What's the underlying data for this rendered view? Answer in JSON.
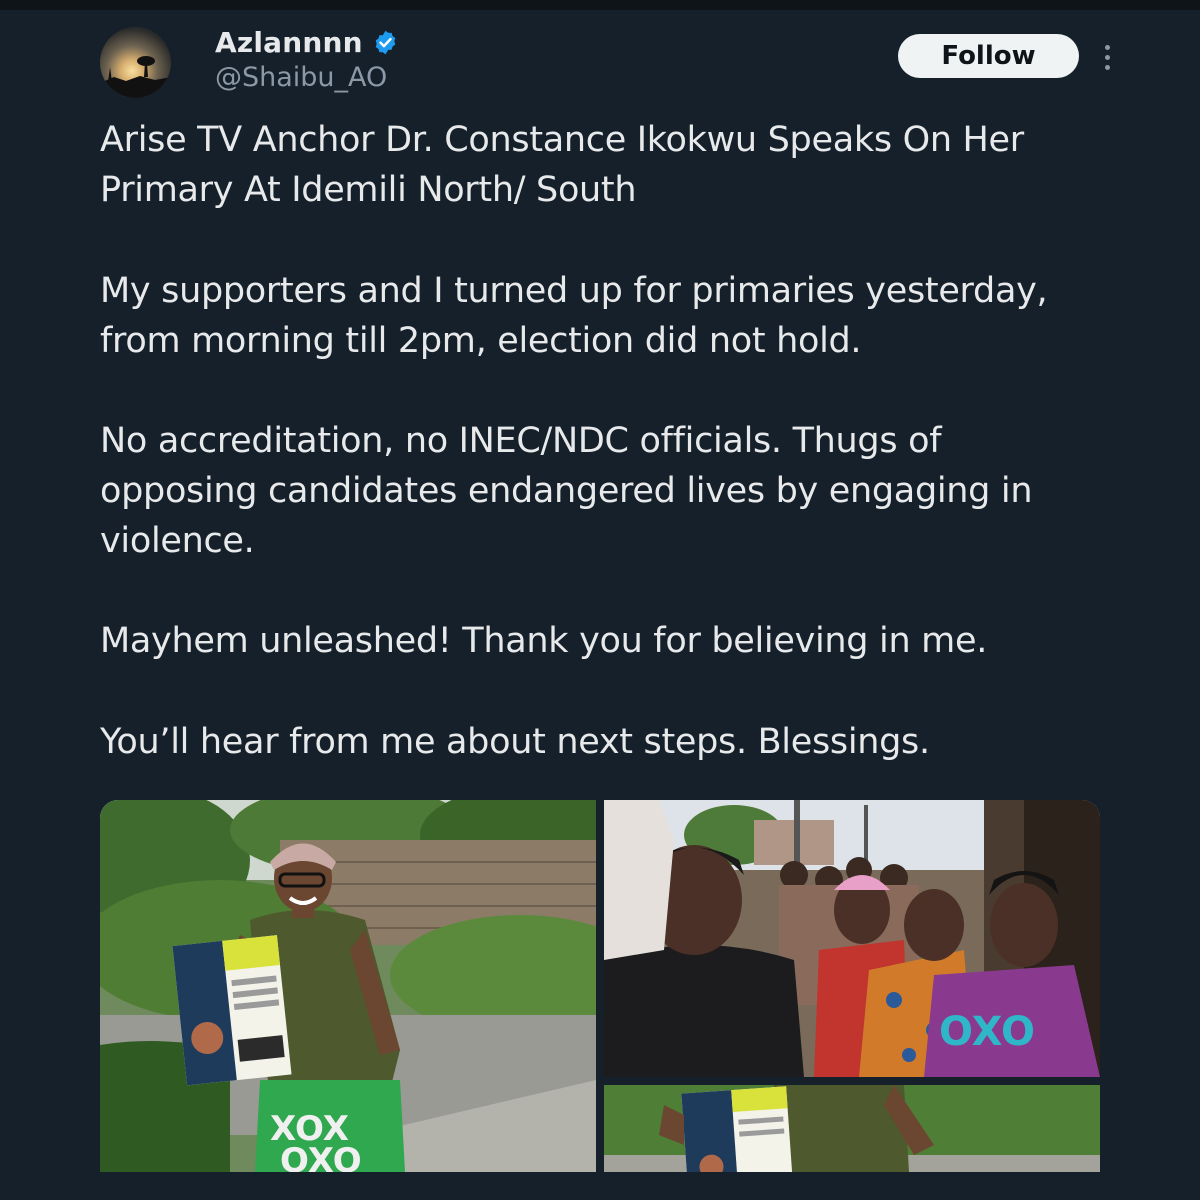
{
  "user": {
    "display_name": "Azlannnn",
    "handle": "@Shaibu_AO",
    "verified": true,
    "avatar": "sunset-silhouette-avatar"
  },
  "actions": {
    "follow_label": "Follow",
    "more_icon": "more-vertical-icon"
  },
  "tweet": {
    "lines": [
      "Arise TV Anchor Dr. Constance Ikokwu Speaks On Her",
      "Primary At Idemili North/ South",
      "My supporters and I turned up for primaries yesterday,",
      "from morning till 2pm, election did not hold.",
      "No accreditation, no INEC/NDC officials. Thugs of",
      "opposing candidates endangered lives by engaging in",
      "violence.",
      "Mayhem unleashed! Thank you for believing in me.",
      "You’ll hear from me about next steps. Blessings."
    ]
  },
  "media": {
    "images": [
      "woman-holding-campaign-flyer-photo",
      "women-supporters-crowd-photo",
      "campaign-flyer-closeup-photo"
    ]
  },
  "colors": {
    "background": "#15202b",
    "text": "#e7e9ea",
    "secondary_text": "#8b98a5",
    "verified_blue": "#1d9bf0",
    "follow_bg": "#eff3f4"
  }
}
